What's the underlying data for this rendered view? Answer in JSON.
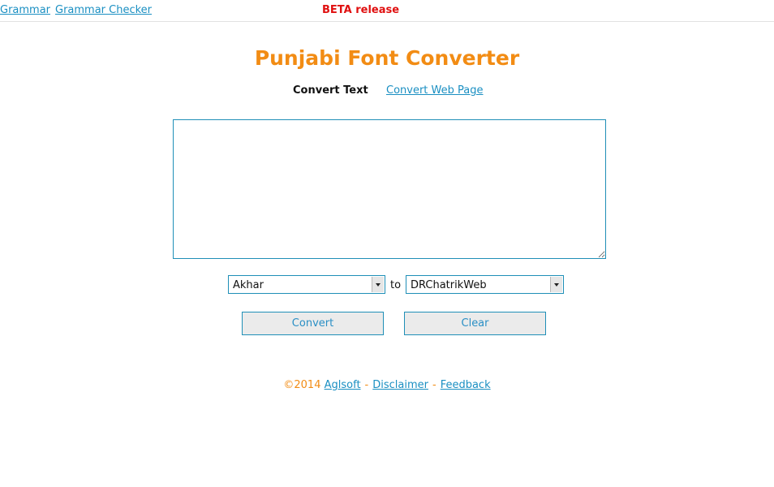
{
  "topbar": {
    "links": [
      {
        "label": "Grammar"
      },
      {
        "label": "Grammar Checker"
      }
    ],
    "beta_label": "BETA release"
  },
  "page": {
    "title": "Punjabi Font Converter",
    "subnav": {
      "current": "Convert Text",
      "link": "Convert Web Page"
    }
  },
  "form": {
    "input_text": "",
    "from_font": "Akhar",
    "to_label": "to",
    "to_font": "DRChatrikWeb",
    "convert_label": "Convert",
    "clear_label": "Clear"
  },
  "footer": {
    "copyright": "©2014",
    "links": [
      {
        "label": "Aglsoft"
      },
      {
        "label": "Disclaimer"
      },
      {
        "label": "Feedback"
      }
    ],
    "separator": "-"
  },
  "colors": {
    "title": "#f28c14",
    "link": "#1a8fc2",
    "beta": "#e01010",
    "border": "#1f8fb7"
  }
}
